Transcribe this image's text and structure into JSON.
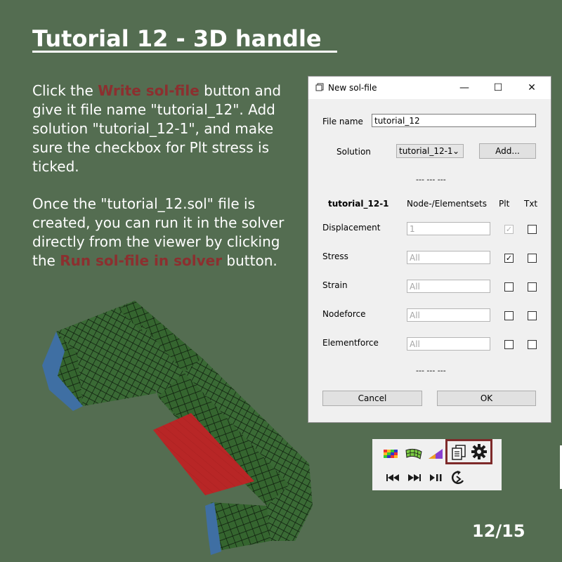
{
  "slide": {
    "title": "Tutorial 12 - 3D handle  ",
    "page_indicator": "12/15",
    "para1": {
      "part1": "Click the ",
      "highlight1": "Write sol-file",
      "part2": " button and give it file name \"tutorial_12\". Add solution \"tutorial_12-1\", and make sure the checkbox for Plt stress is ticked."
    },
    "para2": {
      "part1": "Once the \"tutorial_12.sol\" file is created, you can run it in the solver directly from the viewer by clicking the ",
      "highlight1": "Run sol-file in solver",
      "part2": " button."
    },
    "highlight_color": "#8c2f2f",
    "background_color": "#546d51"
  },
  "dialog": {
    "title": "New sol-file",
    "minimize": "—",
    "maximize": "☐",
    "close": "✕",
    "file_name_label": "File name",
    "file_name_value": "tutorial_12",
    "solution_label": "Solution",
    "solution_selected": "tutorial_12-1",
    "add_label": "Add...",
    "separator": "--- --- ---",
    "table_title": "tutorial_12-1",
    "col_sets": "Node-/Elementsets",
    "col_plt": "Plt",
    "col_txt": "Txt",
    "rows": [
      {
        "label": "Displacement",
        "value": "1",
        "plt": true,
        "plt_disabled": true,
        "txt": false
      },
      {
        "label": "Stress",
        "value": "All",
        "plt": true,
        "plt_disabled": false,
        "txt": false
      },
      {
        "label": "Strain",
        "value": "All",
        "plt": false,
        "plt_disabled": false,
        "txt": false
      },
      {
        "label": "Nodeforce",
        "value": "All",
        "plt": false,
        "plt_disabled": false,
        "txt": false
      },
      {
        "label": "Elementforce",
        "value": "All",
        "plt": false,
        "plt_disabled": false,
        "txt": false
      }
    ],
    "cancel_label": "Cancel",
    "ok_label": "OK"
  },
  "toolbar": {
    "icons": [
      "color-scale-icon",
      "deformed-mesh-icon",
      "gradient-plot-icon",
      "write-sol-file-icon",
      "run-solver-gear-icon",
      "skip-back-icon",
      "skip-forward-icon",
      "play-pause-icon",
      "rotate-icon"
    ],
    "highlight_color": "#7e2a2a"
  },
  "model": {
    "mesh_color": "#3a6a35",
    "stress_color": "#b22424",
    "support_color": "#3f6fa3"
  }
}
